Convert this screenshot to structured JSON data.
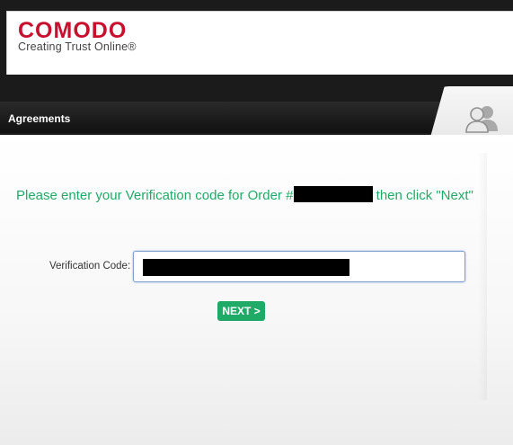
{
  "header": {
    "brand": "COMODO",
    "tagline": "Creating Trust Online®",
    "brand_color": "#c8102e"
  },
  "nav": {
    "agreements_label": "Agreements",
    "user_icon": "users-icon"
  },
  "main": {
    "prompt_prefix": "Please enter your Verification code for Order #",
    "prompt_suffix": " then click \"Next\"",
    "verification_label": "Verification Code:",
    "next_label": "NEXT >",
    "accent_color": "#1fab67"
  }
}
